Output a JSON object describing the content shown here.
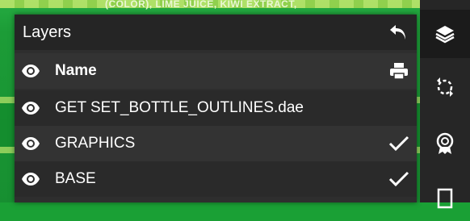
{
  "background": {
    "ingredients_text": "(COLOR), LIME JUICE, KIWI EXTRACT,"
  },
  "layers_panel": {
    "title": "Layers",
    "back_icon": "undo-arrow-icon",
    "header_row": {
      "label": "Name",
      "action_icon": "printer-icon"
    },
    "layers": [
      {
        "label": "GET SET_BOTTLE_OUTLINES.dae",
        "visible": true,
        "checked": false
      },
      {
        "label": "GRAPHICS",
        "visible": true,
        "checked": true
      },
      {
        "label": "BASE",
        "visible": true,
        "checked": true
      }
    ]
  },
  "toolbar": {
    "tools": [
      "layers-stack-icon",
      "rotate-sphere-icon",
      "badge-icon",
      "frame-icon"
    ],
    "active_tool": "layers-stack-icon"
  },
  "colors": {
    "panel": "#2e2e2e",
    "header": "#252525",
    "text": "#ffffff",
    "background_green": "#1aa035"
  }
}
